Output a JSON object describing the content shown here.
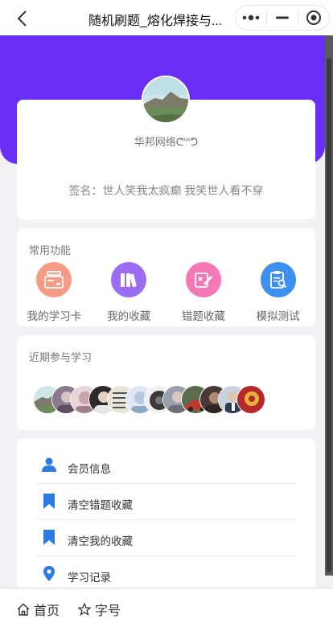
{
  "nav": {
    "title": "随机刷题_熔化焊接与..."
  },
  "profile": {
    "username": "华邦网络ᕦᑋᑋᕤ",
    "signature": "签名：世人笑我太疯癫 我笑世人看不穿"
  },
  "functions": {
    "title": "常用功能",
    "items": [
      {
        "label": "我的学习卡",
        "icon": "card-stack-icon",
        "color": "#f79a86"
      },
      {
        "label": "我的收藏",
        "icon": "books-icon",
        "color": "#9b6df2"
      },
      {
        "label": "错题收藏",
        "icon": "edit-note-icon",
        "color": "#f279b6"
      },
      {
        "label": "模拟测试",
        "icon": "clipboard-search-icon",
        "color": "#3d8ff0"
      }
    ]
  },
  "recent": {
    "title": "近期参与学习",
    "avatars": [
      {
        "icon": "landscape-avatar",
        "color": "#7aa07c"
      },
      {
        "icon": "portrait-avatar",
        "color": "#8b7a8c"
      },
      {
        "icon": "portrait-avatar",
        "color": "#c9a3ad"
      },
      {
        "icon": "portrait-avatar",
        "color": "#2b2b2b"
      },
      {
        "icon": "portrait-avatar",
        "color": "#d8d0c2"
      },
      {
        "icon": "portrait-avatar",
        "color": "#b7c7e0"
      },
      {
        "icon": "portrait-avatar",
        "color": "#3a3a3a"
      },
      {
        "icon": "portrait-avatar",
        "color": "#6e6e78"
      },
      {
        "icon": "portrait-avatar",
        "color": "#c0392b"
      },
      {
        "icon": "portrait-avatar",
        "color": "#4a3a36"
      },
      {
        "icon": "portrait-avatar",
        "color": "#6f7f93"
      },
      {
        "icon": "portrait-avatar",
        "color": "#b5282c"
      }
    ]
  },
  "menu": {
    "items": [
      {
        "label": "会员信息",
        "icon": "user-icon"
      },
      {
        "label": "清空错题收藏",
        "icon": "bookmark-icon"
      },
      {
        "label": "清空我的收藏",
        "icon": "bookmark-icon"
      },
      {
        "label": "学习记录",
        "icon": "location-pin-icon"
      }
    ],
    "icon_color": "#2c7be5"
  },
  "tabbar": {
    "home_label": "首页",
    "font_label": "字号"
  },
  "colors": {
    "header": "#6a2ff6",
    "accent_blue": "#2c7be5"
  }
}
